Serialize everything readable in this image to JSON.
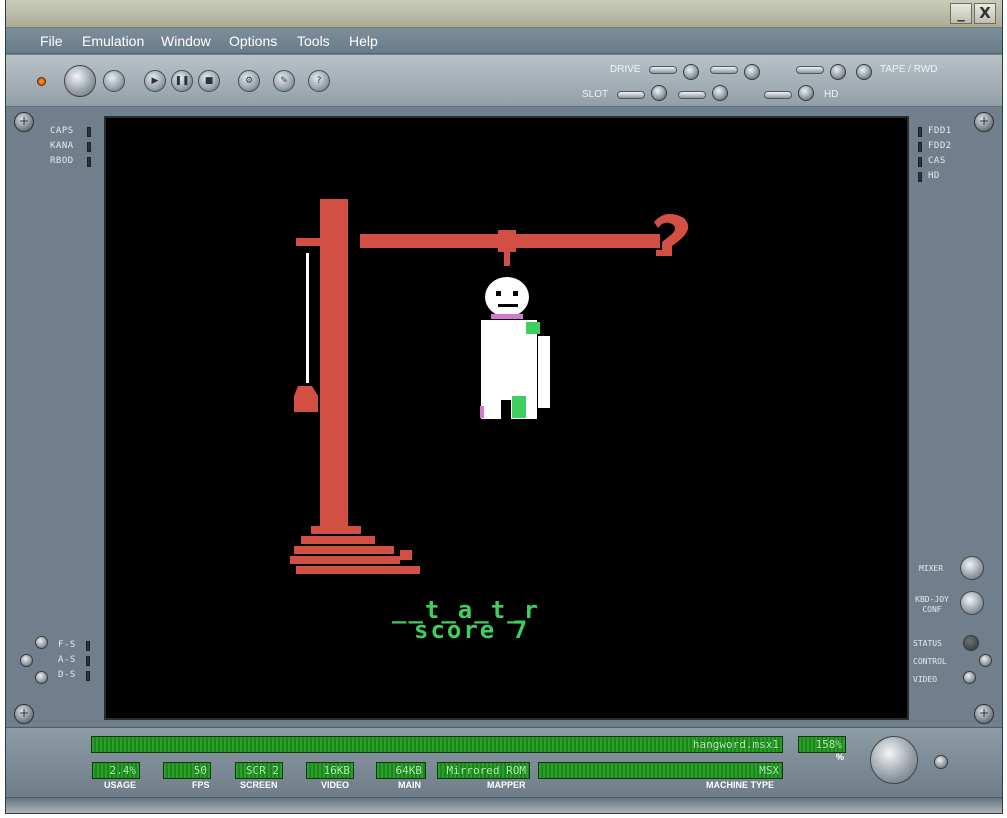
{
  "menu": [
    "File",
    "Emulation",
    "Window",
    "Options",
    "Tools",
    "Help"
  ],
  "window_controls": {
    "minimize": "_",
    "close": "X"
  },
  "toolbar": {
    "drive_label": "DRIVE",
    "slot_label": "SLOT",
    "tape_label": "TAPE / RWD",
    "hd_label": "HD"
  },
  "left_leds": [
    "CAPS",
    "KANA",
    "RBOD"
  ],
  "right_leds": [
    "FDD1",
    "FDD2",
    "CAS",
    "HD"
  ],
  "left_bottom_leds": [
    "F-S",
    "A-S",
    "D-S"
  ],
  "right_controls": {
    "mixer": "MIXER",
    "kbd_joy": "KBD-JOY\nCONF",
    "status": "STATUS",
    "control": "CONTROL",
    "video": "VIDEO"
  },
  "game": {
    "word": "__t_a_t_r",
    "score": "score 7"
  },
  "status": {
    "filename": "hangword.msx1",
    "speed": "158%",
    "percent_caption": "%",
    "usage_value": "2.4%",
    "usage_caption": "USAGE",
    "fps_value": "50",
    "fps_caption": "FPS",
    "screen_value": "SCR 2",
    "screen_caption": "SCREEN",
    "video_value": "16KB",
    "video_caption": "VIDEO",
    "main_value": "64KB",
    "main_caption": "MAIN",
    "mapper_value": "Mirrored ROM",
    "mapper_caption": "MAPPER",
    "machine_value": "MSX",
    "machine_caption": "MACHINE TYPE"
  },
  "colors": {
    "gallows": "#d24f43",
    "text_green": "#3fcf5e",
    "screen_bg": "#000000",
    "lcd": "#1f8a1f"
  }
}
